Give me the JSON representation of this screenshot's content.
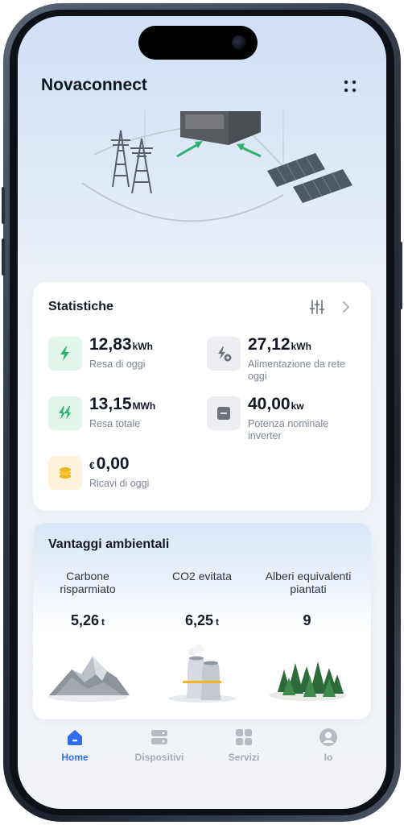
{
  "app": {
    "title": "Novaconnect"
  },
  "stats": {
    "title": "Statistiche",
    "items": [
      {
        "value": "12,83",
        "unit": "kWh",
        "label": "Resa di oggi",
        "icon": "lightning-icon"
      },
      {
        "value": "27,12",
        "unit": "kWh",
        "label": "Alimentazione da rete oggi",
        "icon": "grid-feed-icon"
      },
      {
        "value": "13,15",
        "unit": "MWh",
        "label": "Resa totale",
        "icon": "double-lightning-icon"
      },
      {
        "value": "40,00",
        "unit": "kw",
        "label": "Potenza nominale inverter",
        "icon": "inverter-icon"
      },
      {
        "prefix": "€",
        "value": "0,00",
        "label": "Ricavi di oggi",
        "icon": "coins-icon"
      }
    ]
  },
  "environment": {
    "title": "Vantaggi ambientali",
    "items": [
      {
        "label": "Carbone risparmiato",
        "value": "5,26",
        "unit": "t",
        "icon": "mountain-icon"
      },
      {
        "label": "CO2 evitata",
        "value": "6,25",
        "unit": "t",
        "icon": "cooling-tower-icon"
      },
      {
        "label": "Alberi equivalenti piantati",
        "value": "9",
        "unit": "",
        "icon": "forest-icon"
      }
    ]
  },
  "nav": {
    "items": [
      {
        "label": "Home",
        "icon": "home-icon",
        "active": true
      },
      {
        "label": "Dispositivi",
        "icon": "devices-icon",
        "active": false
      },
      {
        "label": "Servizi",
        "icon": "services-icon",
        "active": false
      },
      {
        "label": "Io",
        "icon": "profile-icon",
        "active": false
      }
    ]
  },
  "colors": {
    "accent": "#2f6ef0",
    "green_icon": "#2fb36b",
    "coin": "#f0b722",
    "muted": "#7e8694"
  }
}
